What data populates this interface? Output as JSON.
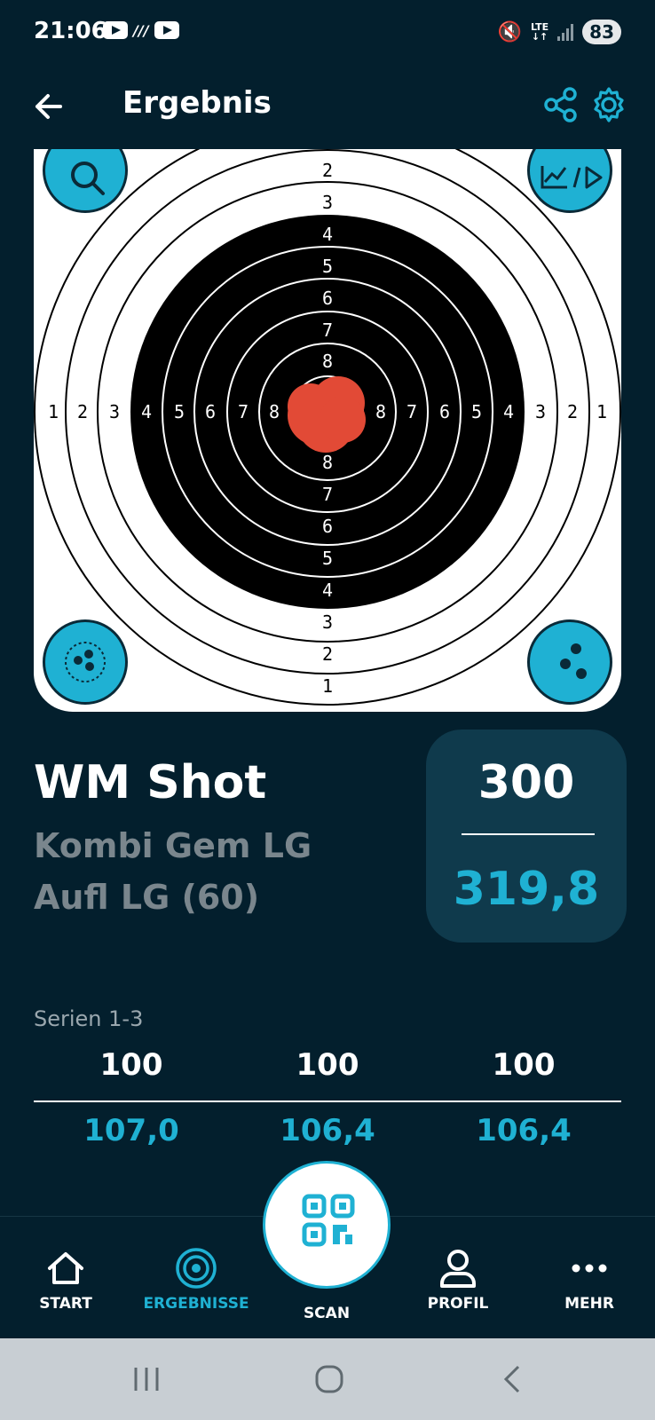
{
  "status": {
    "time": "21:06",
    "network": "LTE",
    "battery": "83"
  },
  "appbar": {
    "title": "Ergebnis"
  },
  "target": {
    "left_ring_numbers": [
      "1",
      "2",
      "3",
      "4",
      "5",
      "6",
      "7",
      "8"
    ],
    "right_ring_numbers": [
      "8",
      "7",
      "6",
      "5",
      "4",
      "3",
      "2",
      "1"
    ],
    "top_ring_numbers": [
      "2",
      "3",
      "4",
      "5",
      "6",
      "7",
      "8"
    ],
    "bottom_ring_numbers": [
      "8",
      "7",
      "6",
      "5",
      "4",
      "3",
      "2",
      "1"
    ],
    "shot_color": "#e24a36"
  },
  "result": {
    "name": "WM Shot",
    "discipline": "Kombi Gem LG Aufl LG (60)",
    "total_int": "300",
    "total_dec": "319,8"
  },
  "series": {
    "label": "Serien 1-3",
    "items": [
      {
        "int": "100",
        "dec": "107,0"
      },
      {
        "int": "100",
        "dec": "106,4"
      },
      {
        "int": "100",
        "dec": "106,4"
      }
    ]
  },
  "nav": {
    "start": "START",
    "results": "ERGEBNISSE",
    "scan": "SCAN",
    "profile": "PROFIL",
    "more": "MEHR"
  },
  "colors": {
    "accent": "#1fb1d3",
    "background": "#031f2d",
    "card": "#0f3a4c"
  }
}
